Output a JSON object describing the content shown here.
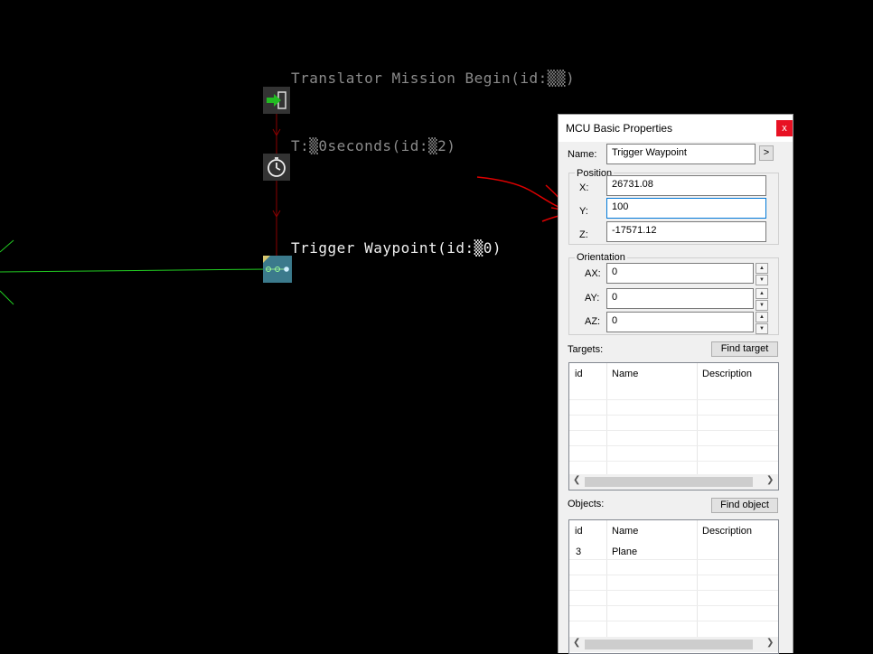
{
  "nodes": {
    "begin_label": "Translator Mission Begin(id:▒▒)",
    "timer_label": "T:▒0seconds(id:▒2)",
    "waypoint_label": "Trigger Waypoint(id:▒0)"
  },
  "dialog": {
    "title": "MCU Basic Properties",
    "close": "x",
    "name_label": "Name:",
    "name_value": "Trigger Waypoint",
    "name_button": ">",
    "position_title": "Position",
    "x_label": "X:",
    "x_value": "26731.08",
    "y_label": "Y:",
    "y_value": "100",
    "z_label": "Z:",
    "z_value": "-17571.12",
    "orientation_title": "Orientation",
    "ax_label": "AX:",
    "ax_value": "0",
    "ay_label": "AY:",
    "ay_value": "0",
    "az_label": "AZ:",
    "az_value": "0",
    "targets_label": "Targets:",
    "find_target": "Find target",
    "objects_label": "Objects:",
    "find_object": "Find object",
    "columns": [
      "id",
      "Name",
      "Description"
    ],
    "objects": [
      {
        "id": "3",
        "name": "Plane",
        "description": ""
      }
    ]
  },
  "colors": {
    "link_line": "#8b0000",
    "green_line": "#22cc22",
    "annotation": "#dd0000",
    "accent": "#0078d7"
  }
}
